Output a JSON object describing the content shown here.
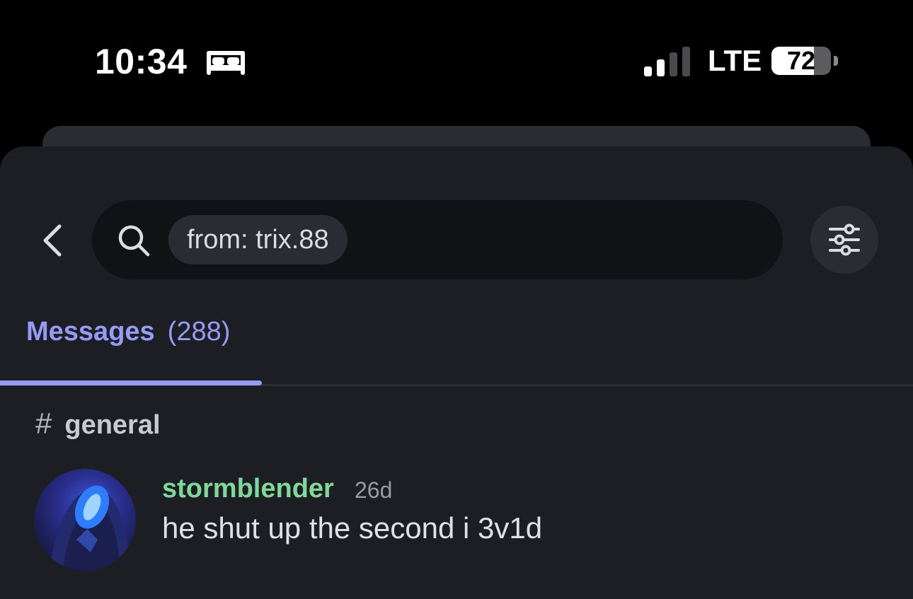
{
  "status_bar": {
    "time": "10:34",
    "sleep_icon": "bed-icon",
    "signal_icon": "cellular-signal-icon",
    "network": "LTE",
    "battery_level": "72",
    "battery_fraction": 0.72
  },
  "search": {
    "back_icon": "chevron-left-icon",
    "search_icon": "search-icon",
    "chip_text": "from: trix.88",
    "filter_icon": "sliders-icon"
  },
  "tabs": [
    {
      "label": "Messages",
      "count": "(288)",
      "active": true
    }
  ],
  "results": {
    "channel": {
      "icon": "hash-icon",
      "name": "general"
    },
    "items": [
      {
        "author": "stormblender",
        "timestamp": "26d",
        "text": "he shut up the second i 3v1d"
      }
    ]
  },
  "colors": {
    "background": "#000000",
    "sheet": "#1d1e23",
    "accent": "#949cf7",
    "author": "#7fd89a"
  }
}
